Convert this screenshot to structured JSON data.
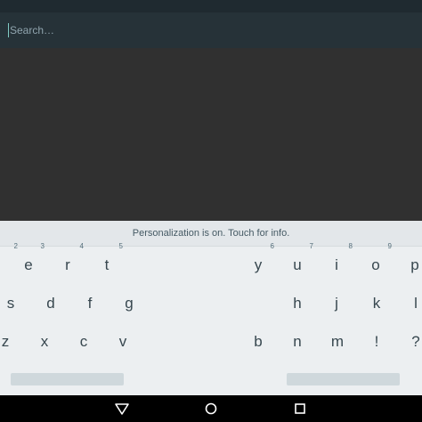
{
  "search": {
    "placeholder": "Search…",
    "value": ""
  },
  "keyboard": {
    "suggestion": "Personalization is on. Touch for info.",
    "row1_left": [
      {
        "key": "",
        "hint": "2"
      },
      {
        "key": "e",
        "hint": "3"
      },
      {
        "key": "r",
        "hint": "4"
      },
      {
        "key": "t",
        "hint": "5"
      }
    ],
    "row1_right": [
      {
        "key": "y",
        "hint": "6"
      },
      {
        "key": "u",
        "hint": "7"
      },
      {
        "key": "i",
        "hint": "8"
      },
      {
        "key": "o",
        "hint": "9"
      },
      {
        "key": "p",
        "hint": "0"
      }
    ],
    "row2_left": [
      "s",
      "d",
      "f",
      "g"
    ],
    "row2_right": [
      "h",
      "j",
      "k",
      "l"
    ],
    "row3_left": [
      "z",
      "x",
      "c",
      "v"
    ],
    "row3_right": [
      "b",
      "n",
      "m",
      "!",
      "?"
    ]
  },
  "nav": {
    "back_icon": "back-triangle-icon",
    "home_icon": "home-circle-icon",
    "recents_icon": "recents-square-icon"
  },
  "colors": {
    "search_bar": "#263238",
    "keyboard_bg": "#eceff1",
    "key_text": "#37474f"
  }
}
